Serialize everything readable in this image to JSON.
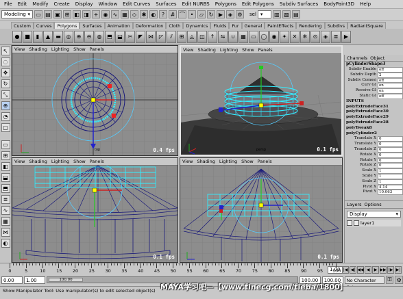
{
  "menubar": [
    "File",
    "Edit",
    "Modify",
    "Create",
    "Display",
    "Window",
    "Edit Curves",
    "Surfaces",
    "Edit NURBS",
    "Polygons",
    "Edit Polygons",
    "Subdiv Surfaces",
    "BodyPaint3D",
    "Help"
  ],
  "statusline": {
    "mode": "Modeling",
    "sel_label": "sel"
  },
  "shelf_tabs": [
    "Custom",
    "Curves",
    "Polygons",
    "Surfaces",
    "Animation",
    "Deformation",
    "Cloth",
    "Dynamics",
    "Fluids",
    "Fur",
    "General",
    "PaintEffects",
    "Rendering",
    "Subdivs",
    "RadiantSquare"
  ],
  "active_shelf": "Polygons",
  "viewport_menu": [
    "View",
    "Shading",
    "Lighting",
    "Show",
    "Panels"
  ],
  "viewports": [
    {
      "camera": "top",
      "fps": "0.4 fps"
    },
    {
      "camera": "persp",
      "fps": "0.1 fps"
    },
    {
      "camera": "",
      "fps": "0.1 fps"
    },
    {
      "camera": "",
      "fps": "0.1 fps"
    }
  ],
  "channel_box": {
    "tabs": [
      "Channels",
      "Object"
    ],
    "shape_node": "pCylinderShape3",
    "shape_attrs": [
      {
        "name": "Subdiv Enable",
        "value": "off"
      },
      {
        "name": "Subdiv Depth",
        "value": "2"
      },
      {
        "name": "Subdiv Comesi",
        "value": "off"
      },
      {
        "name": "Curv GI",
        "value": "on"
      },
      {
        "name": "Receive GI",
        "value": "on"
      },
      {
        "name": "Static GI",
        "value": "off"
      }
    ],
    "inputs_label": "INPUTS",
    "inputs": [
      "polyExtrudeFace31",
      "polyExtrudeFace30",
      "polyExtrudeFace29",
      "polyExtrudeFace28",
      "polyTweak8",
      "polyCylinder2"
    ],
    "cyl_attrs": [
      {
        "name": "Translate X",
        "value": "0"
      },
      {
        "name": "Translate Y",
        "value": "0"
      },
      {
        "name": "Translate Z",
        "value": "0"
      },
      {
        "name": "Rotate X",
        "value": "0"
      },
      {
        "name": "Rotate Y",
        "value": "0"
      },
      {
        "name": "Rotate Z",
        "value": "0"
      },
      {
        "name": "Scale X",
        "value": "1"
      },
      {
        "name": "Scale Y",
        "value": "1"
      },
      {
        "name": "Scale Z",
        "value": "1"
      },
      {
        "name": "Pivot X",
        "value": "4.14"
      },
      {
        "name": "Pivot Y",
        "value": "10.063"
      }
    ]
  },
  "layer_editor": {
    "tabs": [
      "Layers",
      "Options"
    ],
    "display": "Display",
    "layers": [
      "layer1"
    ]
  },
  "timeline": {
    "ticks": [
      "0",
      "5",
      "10",
      "15",
      "20",
      "25",
      "30",
      "35",
      "40",
      "45",
      "50",
      "55",
      "60",
      "65",
      "70",
      "75",
      "80",
      "85",
      "90",
      "95",
      "100"
    ],
    "current_frame": "1.00",
    "start": "0.00",
    "range_start": "1.00",
    "range_end": "100.00",
    "end": "100.00",
    "range_label": "100.00",
    "charset": "No Character Set"
  },
  "helpline": "Show Manipulator Tool: Use manipulator(s) to edit selected object(s)",
  "watermark": "MAYA学习吧—【www.tinecg.com/tieba/1800】"
}
